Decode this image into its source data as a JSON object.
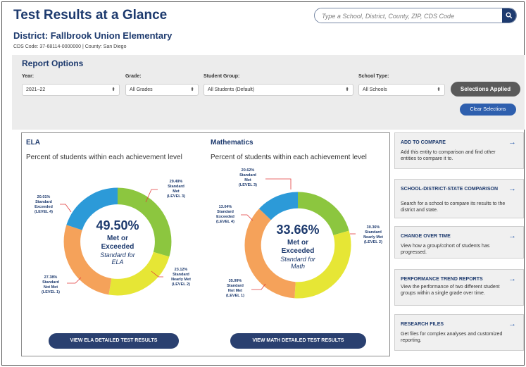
{
  "header": {
    "title": "Test Results at a Glance",
    "search_placeholder": "Type a School, District, County, ZIP, CDS Code"
  },
  "entity": {
    "district": "District: Fallbrook Union Elementary",
    "cds_line": "CDS Code: 37-68114-0000000  |  County: San Diego"
  },
  "report_options": {
    "title": "Report Options",
    "fields": [
      {
        "label": "Year:",
        "value": "2021–22"
      },
      {
        "label": "Grade:",
        "value": "All Grades"
      },
      {
        "label": "Student Group:",
        "value": "All Students (Default)"
      },
      {
        "label": "School Type:",
        "value": "All Schools"
      }
    ],
    "applied_label": "Selections Applied",
    "clear_label": "Clear Selections"
  },
  "ela": {
    "heading": "ELA",
    "subtitle": "Percent of students within each achievement level",
    "center_pct": "49.50%",
    "center_line1": "Met or",
    "center_line2": "Exceeded",
    "center_std1": "Standard for",
    "center_std2": "ELA",
    "segments": [
      {
        "pct": "29.49%",
        "line1": "Standard",
        "line2": "Met",
        "level": "(LEVEL 3)",
        "value": 29.49,
        "color": "#8cc63f"
      },
      {
        "pct": "23.12%",
        "line1": "Standard",
        "line2": "Nearly Met",
        "level": "(LEVEL 2)",
        "value": 23.12,
        "color": "#e6e635"
      },
      {
        "pct": "27.38%",
        "line1": "Standard",
        "line2": "Not Met",
        "level": "(LEVEL 1)",
        "value": 27.38,
        "color": "#f5a25a"
      },
      {
        "pct": "20.01%",
        "line1": "Standard",
        "line2": "Exceeded",
        "level": "(LEVEL 4)",
        "value": 20.01,
        "color": "#2c9ad8"
      }
    ],
    "button_label": "VIEW ELA DETAILED TEST RESULTS"
  },
  "math": {
    "heading": "Mathematics",
    "subtitle": "Percent of students within each achievement level",
    "center_pct": "33.66%",
    "center_line1": "Met or",
    "center_line2": "Exceeded",
    "center_std1": "Standard for",
    "center_std2": "Math",
    "segments": [
      {
        "pct": "20.62%",
        "line1": "Standard",
        "line2": "Met",
        "level": "(LEVEL 3)",
        "value": 20.62,
        "color": "#8cc63f"
      },
      {
        "pct": "30.36%",
        "line1": "Standard",
        "line2": "Nearly Met",
        "level": "(LEVEL 2)",
        "value": 30.36,
        "color": "#e6e635"
      },
      {
        "pct": "35.99%",
        "line1": "Standard",
        "line2": "Not Met",
        "level": "(LEVEL 1)",
        "value": 35.99,
        "color": "#f5a25a"
      },
      {
        "pct": "13.04%",
        "line1": "Standard",
        "line2": "Exceeded",
        "level": "(LEVEL 4)",
        "value": 13.04,
        "color": "#2c9ad8"
      }
    ],
    "button_label": "VIEW MATH DETAILED TEST RESULTS"
  },
  "sidebar": [
    {
      "title": "ADD TO COMPARE",
      "desc": "Add this entity to comparison and find other entities to compare it to."
    },
    {
      "title": "SCHOOL-DISTRICT-STATE COMPARISON",
      "desc": "Search for a school to compare its results to the district and state."
    },
    {
      "title": "CHANGE OVER TIME",
      "desc": "View how a group/cohort of students has progressed."
    },
    {
      "title": "PERFORMANCE TREND REPORTS",
      "desc": "View the performance of two different student groups within a single grade over time."
    },
    {
      "title": "RESEARCH FILES",
      "desc": "Get files for complex analyses and customized reporting."
    }
  ]
}
